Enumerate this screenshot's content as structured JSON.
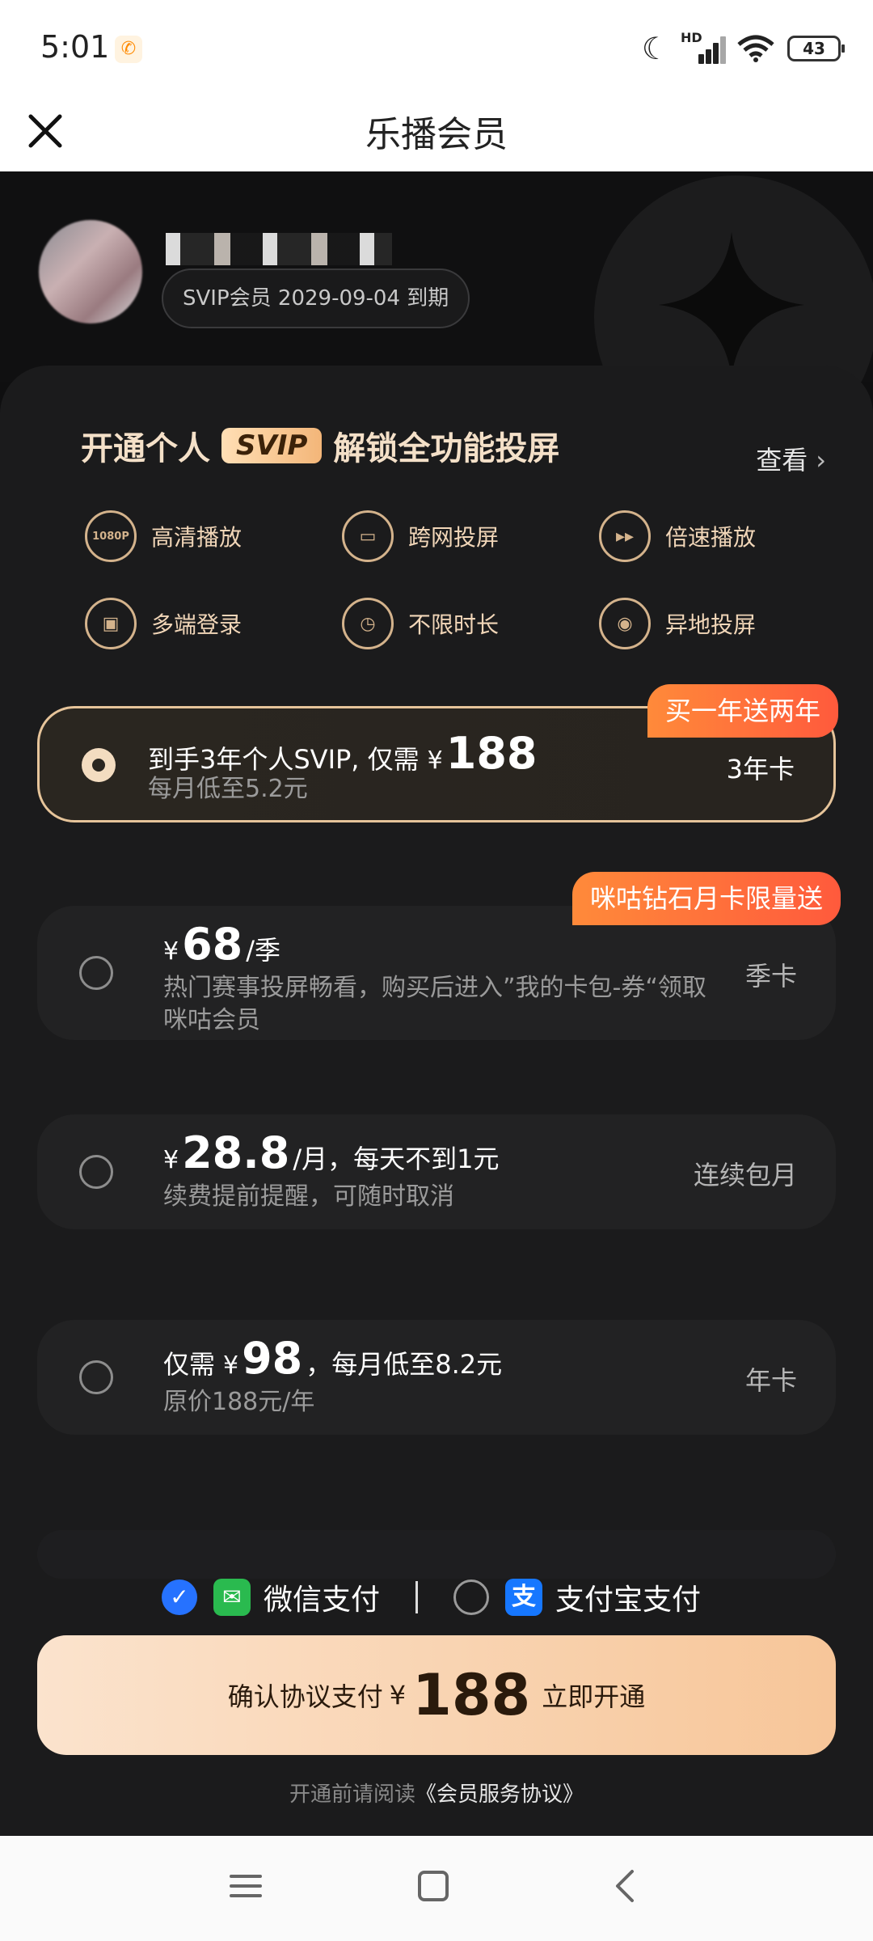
{
  "status_bar": {
    "time": "5:01",
    "battery": "43",
    "network_badge": "HD"
  },
  "header": {
    "title": "乐播会员"
  },
  "profile": {
    "expire_text": "SVIP会员 2029-09-04 到期"
  },
  "benefits": {
    "title_prefix": "开通个人",
    "title_badge": "SVIP",
    "title_suffix": "解锁全功能投屏",
    "view_label": "查看",
    "items": [
      {
        "label": "高清播放",
        "icon": "1080P"
      },
      {
        "label": "跨网投屏",
        "icon": "tv-icon"
      },
      {
        "label": "倍速播放",
        "icon": "fast-forward-icon"
      },
      {
        "label": "多端登录",
        "icon": "devices-icon"
      },
      {
        "label": "不限时长",
        "icon": "clock-icon"
      },
      {
        "label": "异地投屏",
        "icon": "location-icon"
      }
    ]
  },
  "plans": [
    {
      "ribbon": "买一年送两年",
      "line1_prefix": "到手3年个人SVIP, 仅需",
      "yen": "¥",
      "price": "188",
      "line1_suffix": "",
      "line2": "每月低至5.2元",
      "tag": "3年卡",
      "selected": true
    },
    {
      "ribbon": "咪咕钻石月卡限量送",
      "line1_prefix": "",
      "yen": "¥",
      "price": "68",
      "line1_suffix": "/季",
      "line2": "热门赛事投屏畅看，购买后进入”我的卡包-券“领取咪咕会员",
      "tag": "季卡",
      "selected": false
    },
    {
      "ribbon": "",
      "line1_prefix": "",
      "yen": "¥",
      "price": "28.8",
      "line1_suffix": "/月，每天不到1元",
      "line2": "续费提前提醒，可随时取消",
      "tag": "连续包月",
      "selected": false
    },
    {
      "ribbon": "",
      "line1_prefix": "仅需",
      "yen": "¥",
      "price": "98",
      "line1_suffix": "，每月低至8.2元",
      "line2": "原价188元/年",
      "tag": "年卡",
      "selected": false
    }
  ],
  "payment": {
    "wechat_label": "微信支付",
    "alipay_label": "支付宝支付",
    "selected": "wechat"
  },
  "confirm": {
    "prefix": "确认协议支付",
    "yen": "¥",
    "amount": "188",
    "suffix": "立即开通"
  },
  "agreement": {
    "prefix": "开通前请阅读",
    "link": "《会员服务协议》"
  },
  "colors": {
    "accent_gold": "#e6c49a",
    "ribbon": "#ff6a3c",
    "wechat": "#2aba4f",
    "alipay": "#1677ff",
    "check": "#2672ff"
  }
}
